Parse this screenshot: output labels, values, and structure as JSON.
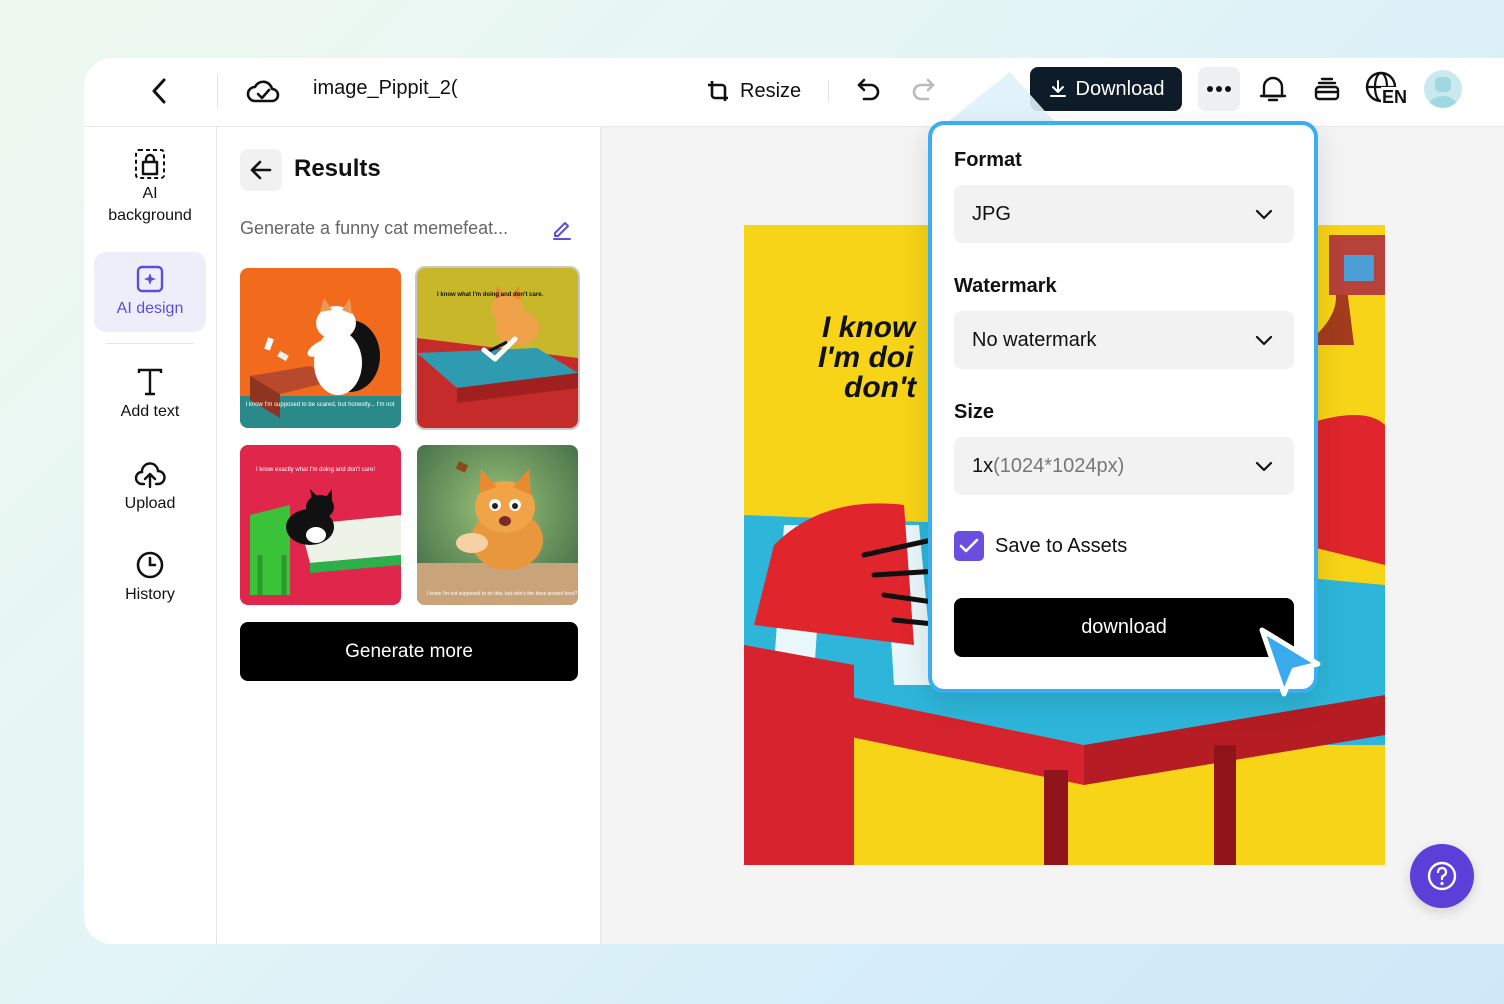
{
  "topbar": {
    "filename": "image_Pippit_2(",
    "resize_label": "Resize",
    "download_label": "Download",
    "lang_code": "EN"
  },
  "rail": {
    "items": [
      {
        "label": "AI background",
        "icon": "ai-background-icon"
      },
      {
        "label": "AI design",
        "icon": "ai-design-icon",
        "active": true
      },
      {
        "label": "Add text",
        "icon": "text-icon"
      },
      {
        "label": "Upload",
        "icon": "upload-cloud-icon"
      },
      {
        "label": "History",
        "icon": "clock-icon"
      }
    ]
  },
  "panel": {
    "title": "Results",
    "prompt": "Generate a funny cat memefeat...",
    "generate_more_label": "Generate more",
    "thumbnails": [
      {
        "caption": "I know I'm supposed to be scared, but honestly... I'm not"
      },
      {
        "caption": "I know what I'm doing and don't care.",
        "selected": true
      },
      {
        "caption": "I know exactly what I'm doing and don't care!"
      },
      {
        "caption": "I know I'm not supposed to do this, but who's the boss around here?"
      }
    ]
  },
  "canvas": {
    "caption_line1": "I know",
    "caption_line2": "I'm doi",
    "caption_line3": "don't"
  },
  "download_menu": {
    "format_label": "Format",
    "format_value": "JPG",
    "watermark_label": "Watermark",
    "watermark_value": "No watermark",
    "size_label": "Size",
    "size_value_main": "1x",
    "size_value_detail": "(1024*1024px)",
    "save_to_assets_label": "Save to Assets",
    "save_to_assets_checked": true,
    "download_button_label": "download"
  },
  "colors": {
    "accent_purple": "#5b4fd6",
    "download_button_bg": "#0e1b29",
    "dropdown_border": "#3aaef0",
    "help_button_bg": "#5b3fd9"
  }
}
